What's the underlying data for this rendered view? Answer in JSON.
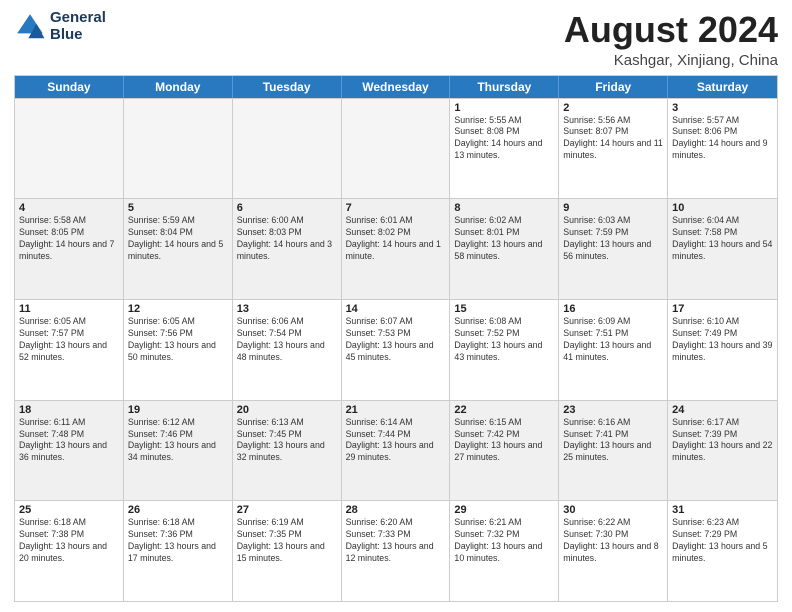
{
  "header": {
    "logo_line1": "General",
    "logo_line2": "Blue",
    "month": "August 2024",
    "location": "Kashgar, Xinjiang, China"
  },
  "days_of_week": [
    "Sunday",
    "Monday",
    "Tuesday",
    "Wednesday",
    "Thursday",
    "Friday",
    "Saturday"
  ],
  "rows": [
    [
      {
        "day": "",
        "empty": true
      },
      {
        "day": "",
        "empty": true
      },
      {
        "day": "",
        "empty": true
      },
      {
        "day": "",
        "empty": true
      },
      {
        "day": "1",
        "sunrise": "5:55 AM",
        "sunset": "8:08 PM",
        "daylight": "14 hours and 13 minutes."
      },
      {
        "day": "2",
        "sunrise": "5:56 AM",
        "sunset": "8:07 PM",
        "daylight": "14 hours and 11 minutes."
      },
      {
        "day": "3",
        "sunrise": "5:57 AM",
        "sunset": "8:06 PM",
        "daylight": "14 hours and 9 minutes."
      }
    ],
    [
      {
        "day": "4",
        "sunrise": "5:58 AM",
        "sunset": "8:05 PM",
        "daylight": "14 hours and 7 minutes."
      },
      {
        "day": "5",
        "sunrise": "5:59 AM",
        "sunset": "8:04 PM",
        "daylight": "14 hours and 5 minutes."
      },
      {
        "day": "6",
        "sunrise": "6:00 AM",
        "sunset": "8:03 PM",
        "daylight": "14 hours and 3 minutes."
      },
      {
        "day": "7",
        "sunrise": "6:01 AM",
        "sunset": "8:02 PM",
        "daylight": "14 hours and 1 minute."
      },
      {
        "day": "8",
        "sunrise": "6:02 AM",
        "sunset": "8:01 PM",
        "daylight": "13 hours and 58 minutes."
      },
      {
        "day": "9",
        "sunrise": "6:03 AM",
        "sunset": "7:59 PM",
        "daylight": "13 hours and 56 minutes."
      },
      {
        "day": "10",
        "sunrise": "6:04 AM",
        "sunset": "7:58 PM",
        "daylight": "13 hours and 54 minutes."
      }
    ],
    [
      {
        "day": "11",
        "sunrise": "6:05 AM",
        "sunset": "7:57 PM",
        "daylight": "13 hours and 52 minutes."
      },
      {
        "day": "12",
        "sunrise": "6:05 AM",
        "sunset": "7:56 PM",
        "daylight": "13 hours and 50 minutes."
      },
      {
        "day": "13",
        "sunrise": "6:06 AM",
        "sunset": "7:54 PM",
        "daylight": "13 hours and 48 minutes."
      },
      {
        "day": "14",
        "sunrise": "6:07 AM",
        "sunset": "7:53 PM",
        "daylight": "13 hours and 45 minutes."
      },
      {
        "day": "15",
        "sunrise": "6:08 AM",
        "sunset": "7:52 PM",
        "daylight": "13 hours and 43 minutes."
      },
      {
        "day": "16",
        "sunrise": "6:09 AM",
        "sunset": "7:51 PM",
        "daylight": "13 hours and 41 minutes."
      },
      {
        "day": "17",
        "sunrise": "6:10 AM",
        "sunset": "7:49 PM",
        "daylight": "13 hours and 39 minutes."
      }
    ],
    [
      {
        "day": "18",
        "sunrise": "6:11 AM",
        "sunset": "7:48 PM",
        "daylight": "13 hours and 36 minutes."
      },
      {
        "day": "19",
        "sunrise": "6:12 AM",
        "sunset": "7:46 PM",
        "daylight": "13 hours and 34 minutes."
      },
      {
        "day": "20",
        "sunrise": "6:13 AM",
        "sunset": "7:45 PM",
        "daylight": "13 hours and 32 minutes."
      },
      {
        "day": "21",
        "sunrise": "6:14 AM",
        "sunset": "7:44 PM",
        "daylight": "13 hours and 29 minutes."
      },
      {
        "day": "22",
        "sunrise": "6:15 AM",
        "sunset": "7:42 PM",
        "daylight": "13 hours and 27 minutes."
      },
      {
        "day": "23",
        "sunrise": "6:16 AM",
        "sunset": "7:41 PM",
        "daylight": "13 hours and 25 minutes."
      },
      {
        "day": "24",
        "sunrise": "6:17 AM",
        "sunset": "7:39 PM",
        "daylight": "13 hours and 22 minutes."
      }
    ],
    [
      {
        "day": "25",
        "sunrise": "6:18 AM",
        "sunset": "7:38 PM",
        "daylight": "13 hours and 20 minutes."
      },
      {
        "day": "26",
        "sunrise": "6:18 AM",
        "sunset": "7:36 PM",
        "daylight": "13 hours and 17 minutes."
      },
      {
        "day": "27",
        "sunrise": "6:19 AM",
        "sunset": "7:35 PM",
        "daylight": "13 hours and 15 minutes."
      },
      {
        "day": "28",
        "sunrise": "6:20 AM",
        "sunset": "7:33 PM",
        "daylight": "13 hours and 12 minutes."
      },
      {
        "day": "29",
        "sunrise": "6:21 AM",
        "sunset": "7:32 PM",
        "daylight": "13 hours and 10 minutes."
      },
      {
        "day": "30",
        "sunrise": "6:22 AM",
        "sunset": "7:30 PM",
        "daylight": "13 hours and 8 minutes."
      },
      {
        "day": "31",
        "sunrise": "6:23 AM",
        "sunset": "7:29 PM",
        "daylight": "13 hours and 5 minutes."
      }
    ]
  ]
}
